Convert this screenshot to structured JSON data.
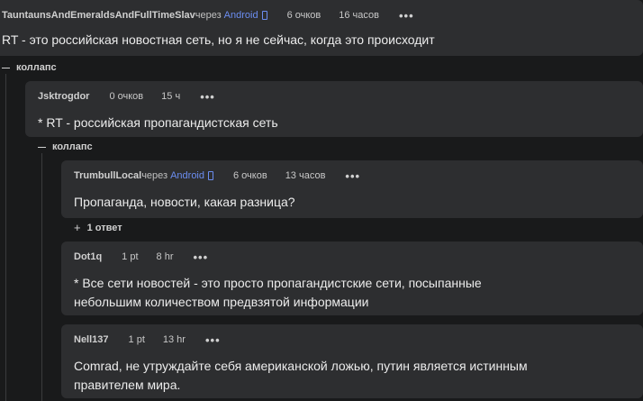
{
  "comments": [
    {
      "user": "TauntaunsAndEmeraldsAndFullTimeSlav",
      "via": "через",
      "platform": "Android",
      "points": "6 очков",
      "time": "16 часов",
      "text": "RT - это российская новостная сеть, но я не сейчас, когда это происходит"
    },
    {
      "user": "Jsktrogdor",
      "points": "0 очков",
      "time": "15 ч",
      "text": "* RT - российская пропагандистская сеть"
    },
    {
      "user": "TrumbullLocal",
      "via": "через",
      "platform": "Android",
      "points": "6 очков",
      "time": "13 часов",
      "text": "Пропаганда, новости, какая разница?"
    },
    {
      "user": "Dot1q",
      "points": "1 pt",
      "time": "8 hr",
      "text": "* Все сети новостей - это просто пропагандистские сети, посыпанные небольшим количеством предвзятой информации"
    },
    {
      "user": "Nell137",
      "points": "1 pt",
      "time": "13 hr",
      "text": "Comrad, не утруждайте себя американской ложью, путин является истинным правителем мира."
    }
  ],
  "more_icon": "more-dots-icon",
  "collapse_label": "коллапс",
  "replies_label": "1 ответ",
  "colors": {
    "background": "#191a1b",
    "card": "#2d2e30",
    "android": "#6b8df0"
  }
}
